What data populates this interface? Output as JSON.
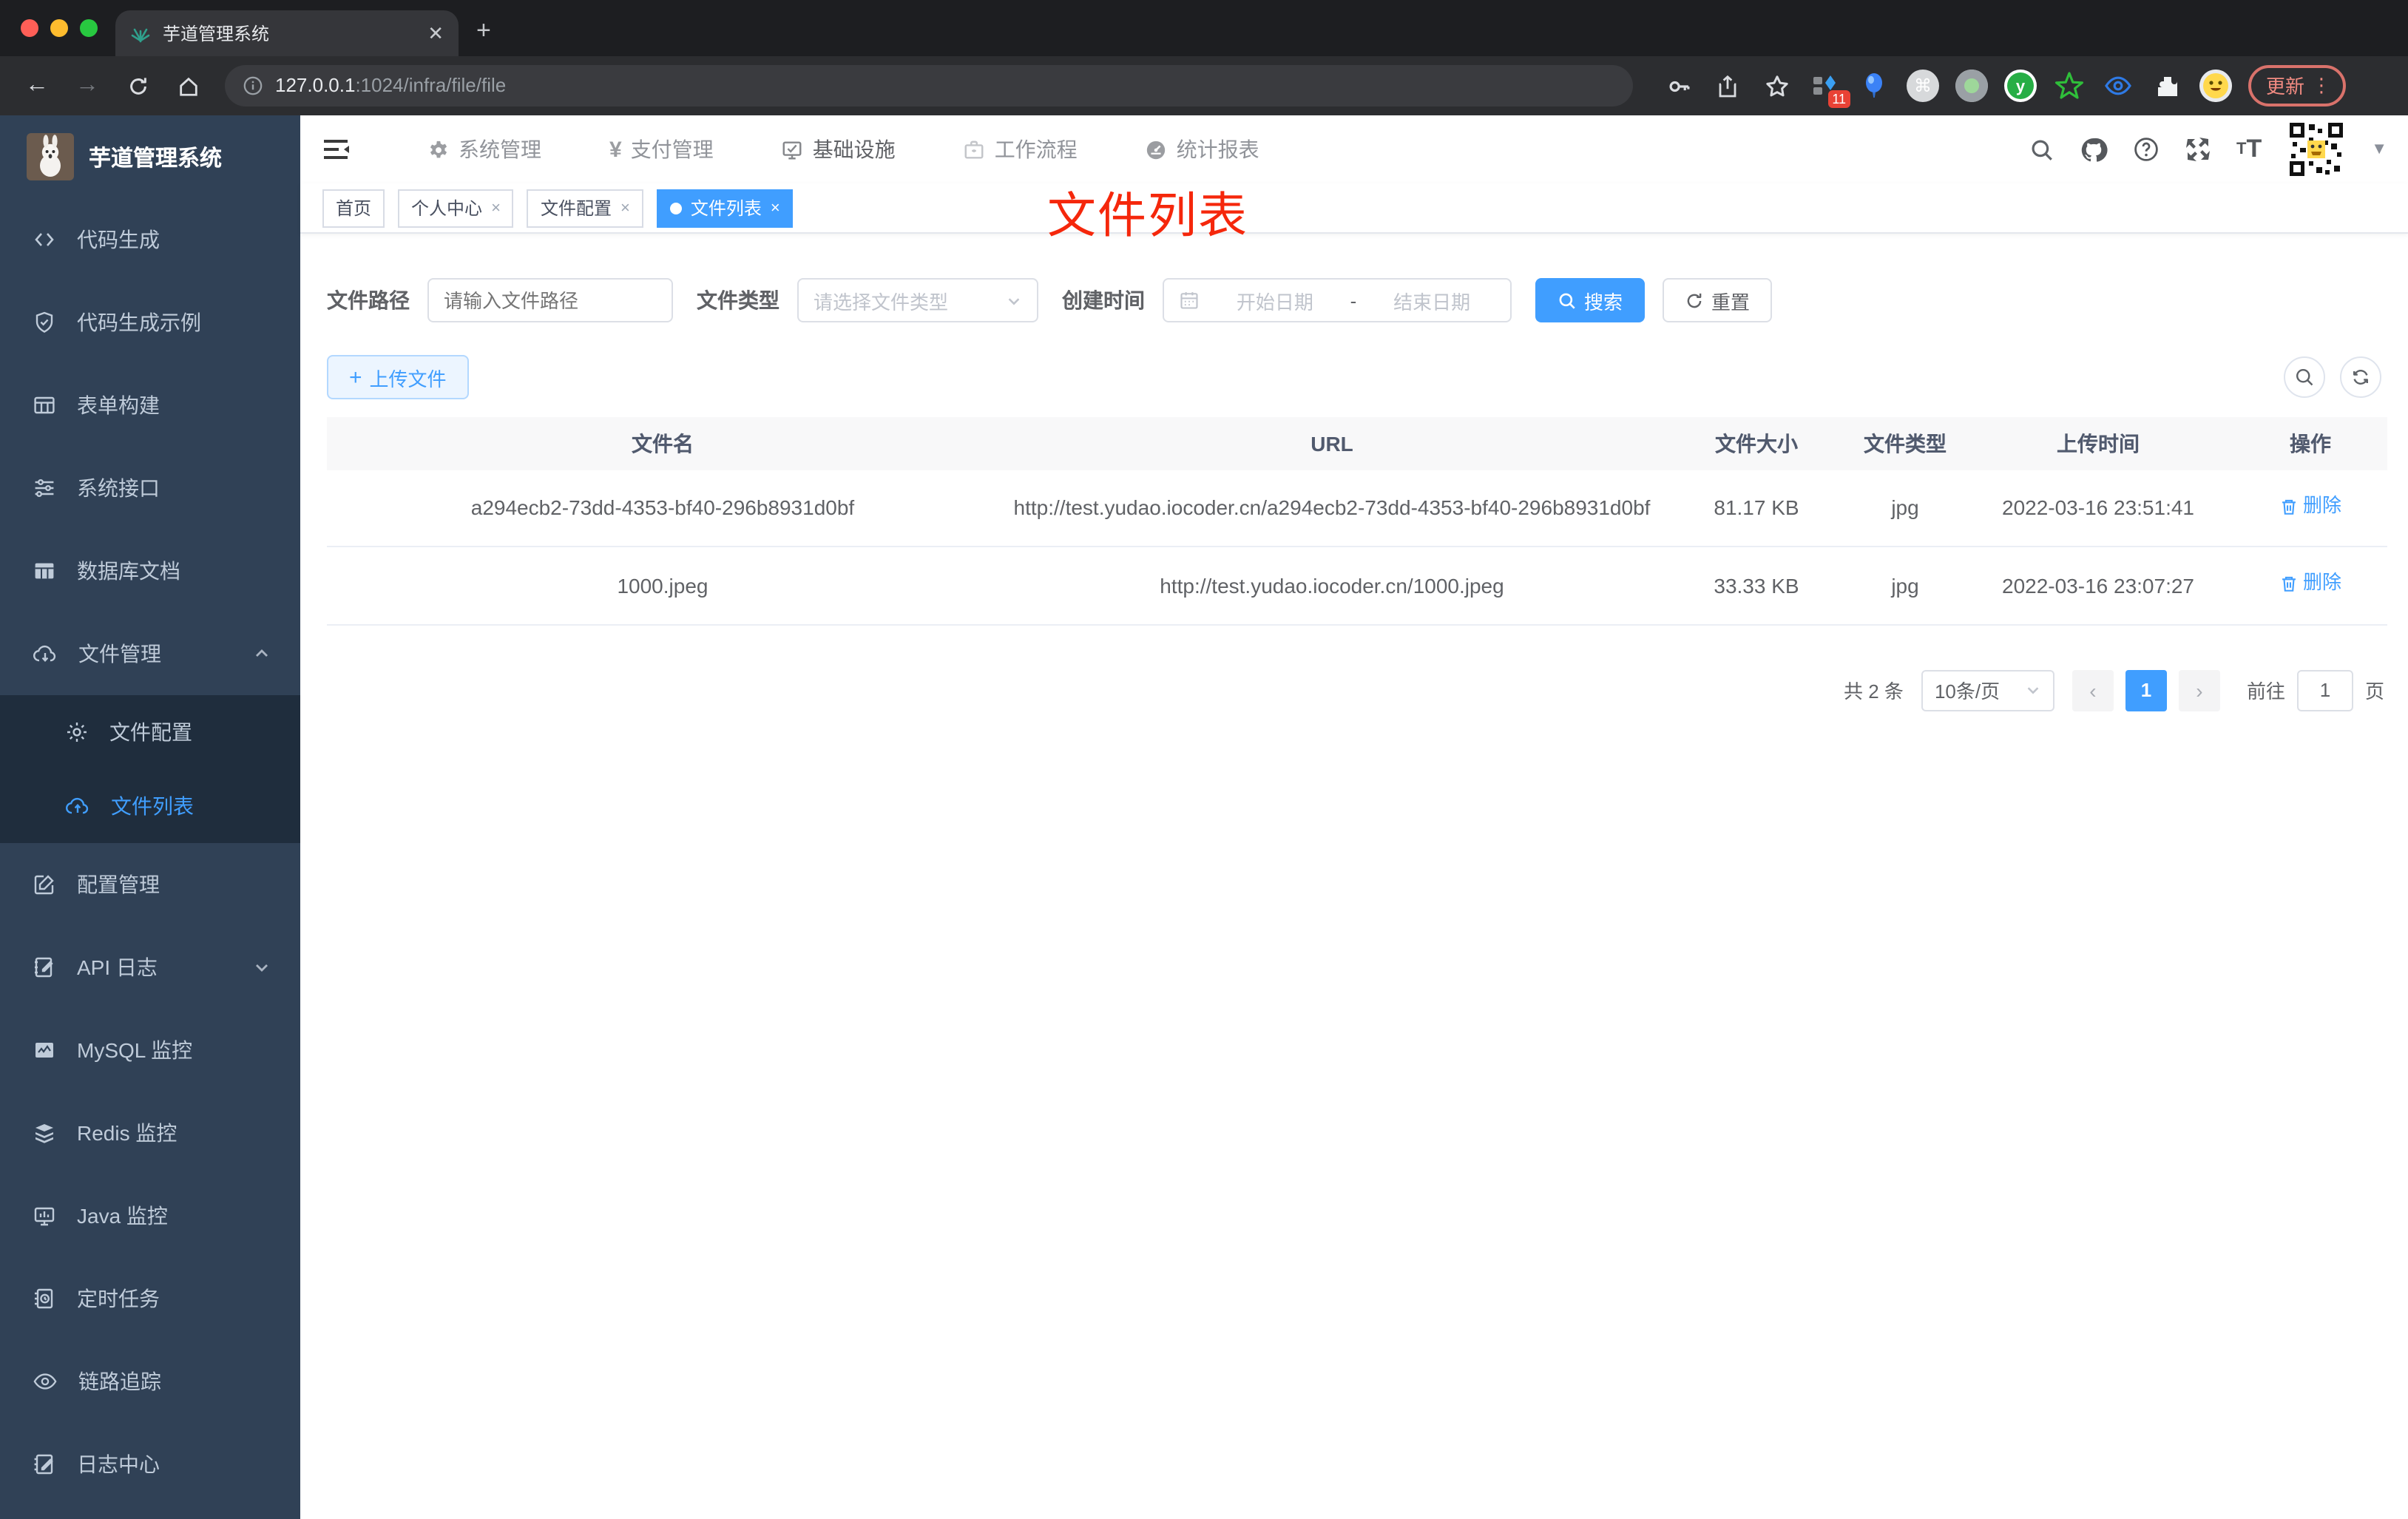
{
  "colors": {
    "accent": "#409eff",
    "annotation_red": "#f5270b",
    "sidebar_bg": "#304156",
    "submenu_bg": "#1f2d3d"
  },
  "browser": {
    "tab_title": "芋道管理系统",
    "url_main": "127.0.0.1",
    "url_rest": ":1024/infra/file/file",
    "ext_badge": "11",
    "update_label": "更新"
  },
  "sidebar": {
    "title": "芋道管理系统",
    "items": [
      {
        "label": "代码生成"
      },
      {
        "label": "代码生成示例"
      },
      {
        "label": "表单构建"
      },
      {
        "label": "系统接口"
      },
      {
        "label": "数据库文档"
      },
      {
        "label": "文件管理"
      },
      {
        "label": "配置管理"
      },
      {
        "label": "API 日志"
      },
      {
        "label": "MySQL 监控"
      },
      {
        "label": "Redis 监控"
      },
      {
        "label": "Java 监控"
      },
      {
        "label": "定时任务"
      },
      {
        "label": "链路追踪"
      },
      {
        "label": "日志中心"
      }
    ],
    "file_children": [
      {
        "label": "文件配置"
      },
      {
        "label": "文件列表"
      }
    ]
  },
  "header": {
    "nav": [
      {
        "label": "系统管理"
      },
      {
        "label": "支付管理"
      },
      {
        "label": "基础设施"
      },
      {
        "label": "工作流程"
      },
      {
        "label": "统计报表"
      }
    ],
    "yen_glyph": "¥"
  },
  "tags": {
    "items": [
      {
        "label": "首页"
      },
      {
        "label": "个人中心"
      },
      {
        "label": "文件配置"
      },
      {
        "label": "文件列表"
      }
    ],
    "close_glyph": "×"
  },
  "annotation": "文件列表",
  "filter": {
    "path_label": "文件路径",
    "path_placeholder": "请输入文件路径",
    "type_label": "文件类型",
    "type_placeholder": "请选择文件类型",
    "date_label": "创建时间",
    "date_start": "开始日期",
    "date_sep": "-",
    "date_end": "结束日期",
    "search_label": "搜索",
    "reset_label": "重置"
  },
  "toolbar": {
    "upload_label": "上传文件",
    "plus_glyph": "+"
  },
  "table": {
    "headers": [
      "文件名",
      "URL",
      "文件大小",
      "文件类型",
      "上传时间",
      "操作"
    ],
    "rows": [
      {
        "name": "a294ecb2-73dd-4353-bf40-296b8931d0bf",
        "url": "http://test.yudao.iocoder.cn/a294ecb2-73dd-4353-bf40-296b8931d0bf",
        "size": "81.17 KB",
        "type": "jpg",
        "time": "2022-03-16 23:51:41",
        "action": "删除"
      },
      {
        "name": "1000.jpeg",
        "url": "http://test.yudao.iocoder.cn/1000.jpeg",
        "size": "33.33 KB",
        "type": "jpg",
        "time": "2022-03-16 23:07:27",
        "action": "删除"
      }
    ]
  },
  "pagination": {
    "total": "共 2 条",
    "size": "10条/页",
    "prev": "‹",
    "page": "1",
    "next": "›",
    "goto_label": "前往",
    "goto_value": "1",
    "unit": "页"
  }
}
